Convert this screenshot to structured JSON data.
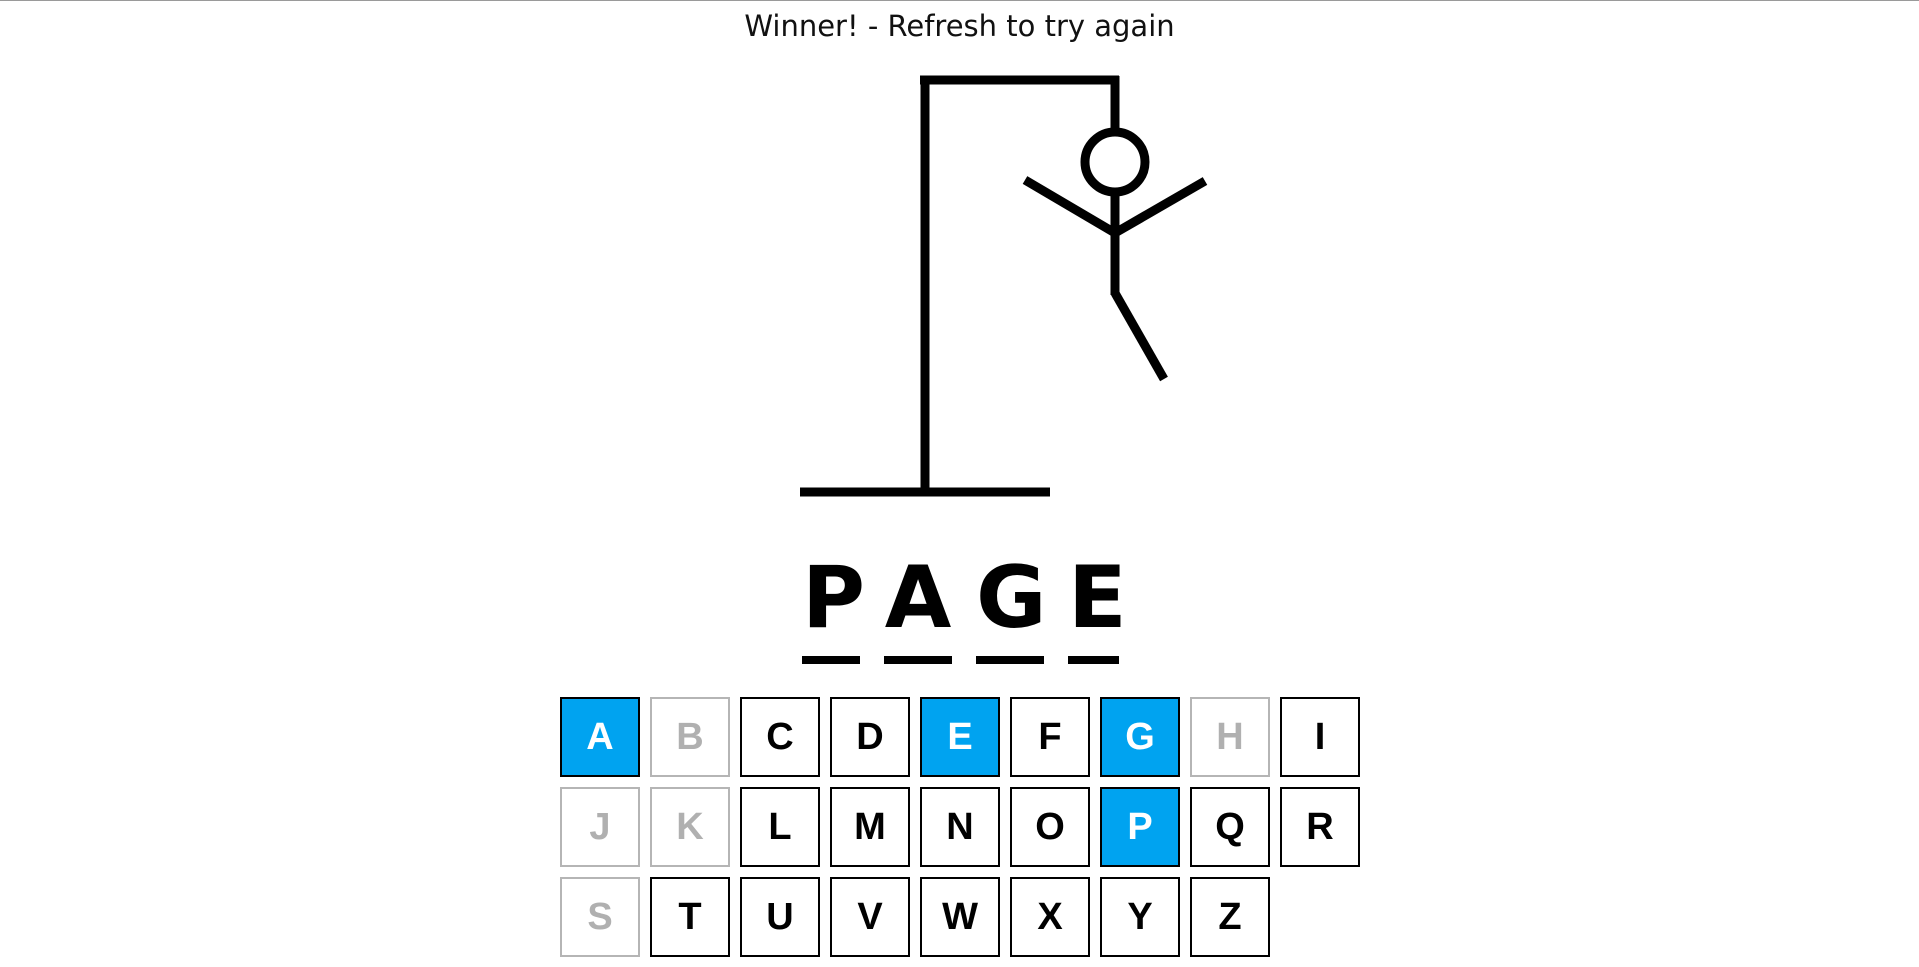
{
  "status": {
    "message": "Winner! - Refresh to try again"
  },
  "word": {
    "letters": [
      "P",
      "A",
      "G",
      "E"
    ]
  },
  "keyboard": {
    "rows": [
      [
        {
          "letter": "A",
          "state": "correct"
        },
        {
          "letter": "B",
          "state": "wrong"
        },
        {
          "letter": "C",
          "state": "unused"
        },
        {
          "letter": "D",
          "state": "unused"
        },
        {
          "letter": "E",
          "state": "correct"
        },
        {
          "letter": "F",
          "state": "unused"
        },
        {
          "letter": "G",
          "state": "correct"
        },
        {
          "letter": "H",
          "state": "wrong"
        },
        {
          "letter": "I",
          "state": "unused"
        }
      ],
      [
        {
          "letter": "J",
          "state": "wrong"
        },
        {
          "letter": "K",
          "state": "wrong"
        },
        {
          "letter": "L",
          "state": "unused"
        },
        {
          "letter": "M",
          "state": "unused"
        },
        {
          "letter": "N",
          "state": "unused"
        },
        {
          "letter": "O",
          "state": "unused"
        },
        {
          "letter": "P",
          "state": "correct"
        },
        {
          "letter": "Q",
          "state": "unused"
        },
        {
          "letter": "R",
          "state": "unused"
        }
      ],
      [
        {
          "letter": "S",
          "state": "wrong"
        },
        {
          "letter": "T",
          "state": "unused"
        },
        {
          "letter": "U",
          "state": "unused"
        },
        {
          "letter": "V",
          "state": "unused"
        },
        {
          "letter": "W",
          "state": "unused"
        },
        {
          "letter": "X",
          "state": "unused"
        },
        {
          "letter": "Y",
          "state": "unused"
        },
        {
          "letter": "Z",
          "state": "unused"
        }
      ]
    ]
  },
  "colors": {
    "correct": "#00a3f0",
    "wrong_border": "#b5b5b5",
    "wrong_text": "#b0b0b0",
    "ink": "#000000"
  }
}
